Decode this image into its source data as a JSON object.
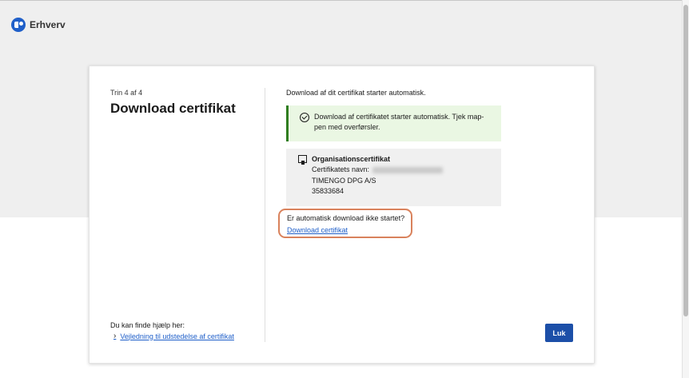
{
  "header": {
    "logo_text": "Erhverv",
    "logo_icon": "erhverv-logo-icon"
  },
  "wizard": {
    "step_label": "Trin 4 af 4",
    "title": "Download certifikat",
    "help": {
      "title": "Du kan finde hjælp her:",
      "link_label": "Vejledning til udstedelse af certifikat"
    }
  },
  "main": {
    "intro": "Download af dit certifikat starter automatisk.",
    "alert": {
      "icon": "check-circle-icon",
      "text": "Download af certifikatet starter automatisk. Tjek map-pen med overførsler.",
      "color": "#2f7d1f"
    },
    "certificate": {
      "icon": "certificate-icon",
      "type": "Organisationscertifikat",
      "name_label": "Certifikatets navn:",
      "company": "TIMENGO DPG A/S",
      "cvr": "35833684"
    },
    "fallback": {
      "question": "Er automatisk download ikke startet?",
      "link_label": "Download certifikat",
      "highlight_color": "#d9825c"
    },
    "close_button_label": "Luk"
  },
  "colors": {
    "accent": "#1f5fc9",
    "button": "#1c4fa8"
  }
}
